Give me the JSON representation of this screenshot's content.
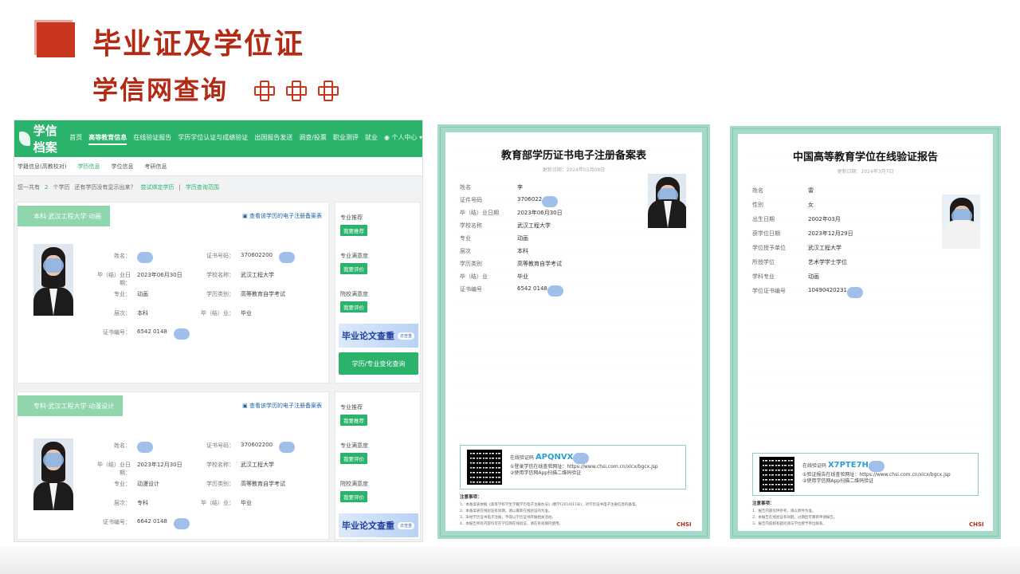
{
  "slide": {
    "title_line1": "毕业证及学位证",
    "title_line2": "学信网查询"
  },
  "xuexin": {
    "logo": "学信档案",
    "nav": [
      "首页",
      "高等教育信息",
      "在线验证报告",
      "学历学位认证与成绩验证",
      "出国报告发送",
      "调查/投票",
      "职业测评",
      "就业",
      "个人中心"
    ],
    "sub_tabs": [
      "学籍信息(高教校对)",
      "学历信息",
      "学位信息",
      "考研信息"
    ],
    "count": {
      "prefix": "您一共有",
      "num": "2",
      "suffix": "个学历",
      "missing": "还有学历没有显示出来？",
      "try": "尝试绑定学历",
      "sep": "|",
      "query": "学历查询范围"
    },
    "records": [
      {
        "tag": "本科·武汉工程大学·动画",
        "link": "查看该学历的电子注册备案表",
        "fields": [
          {
            "l": "姓名：",
            "v": ""
          },
          {
            "l": "入学日期：",
            "v": ""
          },
          {
            "l": "毕（结）业日期：",
            "v": "2023年06月30日"
          },
          {
            "l": "专业：",
            "v": "动画"
          },
          {
            "l": "层次：",
            "v": "本科"
          },
          {
            "l": "证书编号：",
            "v": "6542 0148"
          }
        ],
        "fields2": [
          {
            "l": "证书号码：",
            "v": "370602200"
          },
          {
            "l": "学校名称：",
            "v": "武汉工程大学"
          },
          {
            "l": "学历类别：",
            "v": "高等教育自学考试"
          },
          {
            "l": "毕（结）业：",
            "v": "毕业"
          }
        ]
      },
      {
        "tag": "专科·武汉工程大学·动漫设计",
        "link": "查看该学历的电子注册备案表",
        "fields": [
          {
            "l": "姓名：",
            "v": ""
          },
          {
            "l": "毕（结）业日期：",
            "v": "2023年12月30日"
          },
          {
            "l": "专业：",
            "v": "动漫设计"
          },
          {
            "l": "层次：",
            "v": "专科"
          },
          {
            "l": "证书编号：",
            "v": "6642 0148"
          }
        ],
        "fields2": [
          {
            "l": "证书号码：",
            "v": "370602200"
          },
          {
            "l": "学校名称：",
            "v": "武汉工程大学"
          },
          {
            "l": "学历类别：",
            "v": "高等教育自学考试"
          },
          {
            "l": "毕（结）业：",
            "v": "毕业"
          }
        ]
      }
    ],
    "side": {
      "l1": "专业推荐",
      "b1": "我要推荐",
      "l2": "专业满意度",
      "b2": "我要评价",
      "l3": "院校满意度",
      "b3": "我要评价",
      "ad": "毕业论文查重",
      "ad_search": "去查重",
      "change": "学历/专业变化查询"
    }
  },
  "cert1": {
    "title": "教育部学历证书电子注册备案表",
    "date": "更新日期：2024年03月08日",
    "rows": [
      {
        "l": "姓名",
        "v": "李"
      },
      {
        "l": "证件号码",
        "v": "3706022"
      },
      {
        "l": "毕（结）业日期",
        "v": "2023年06月30日"
      },
      {
        "l": "学校名称",
        "v": "武汉工程大学"
      },
      {
        "l": "专业",
        "v": "动画"
      },
      {
        "l": "层次",
        "v": "本科"
      },
      {
        "l": "学历类别",
        "v": "高等教育自学考试"
      },
      {
        "l": "毕（结）业",
        "v": "毕业"
      },
      {
        "l": "证书编号",
        "v": "6542 0148"
      }
    ],
    "verify": {
      "code_label": "在线验证码",
      "code": "APQNVX",
      "line1": "①登录学信在线查验网址：https://www.chsi.com.cn/xlcx/bgcx.jsp",
      "line2": "②使用学信网App扫描二维码验证"
    },
    "notes_title": "注意事项：",
    "notes": [
      "1、本备案表依据《高等学校学生学籍学历电子注册办法》(教学[2014]11号)，对学历证书电子注册信息的备案。",
      "2、本备案表在线验证有效期，请以最新在线验证的为准。",
      "3、未经学历证书电子注册，不得以学历证书开展相关活动。",
      "4、本报告所有内容均可在学信网在线验证，请在有效期内使用。"
    ],
    "logo": "CHSI"
  },
  "cert2": {
    "title": "中国高等教育学位在线验证报告",
    "date": "更新日期：2024年3月7日",
    "rows": [
      {
        "l": "姓名",
        "v": "雷"
      },
      {
        "l": "性别",
        "v": "女"
      },
      {
        "l": "出生日期",
        "v": "2002年03月"
      },
      {
        "l": "获学位日期",
        "v": "2023年12月29日"
      },
      {
        "l": "学位授予单位",
        "v": "武汉工程大学"
      },
      {
        "l": "所授学位",
        "v": "艺术学学士学位"
      },
      {
        "l": "学科专业",
        "v": "动画"
      },
      {
        "l": "学位证书编号",
        "v": "10490420231"
      }
    ],
    "verify": {
      "code_label": "在线验证码",
      "code": "X7PTE7H",
      "line1": "①验证报告在线查验网址：https://www.chsi.com.cn/xlcx/bgcx.jsp",
      "line2": "②使用学信网App扫描二维码验证"
    },
    "notes_title": "注意事项：",
    "notes": [
      "1、报告内容仅供参考，请以原件为准。",
      "2、本报告在线验证有效期，过期后可重新申请报告。",
      "3、报告内容如有疑问请与学位授予单位联系。"
    ],
    "logo": "CHSI"
  }
}
